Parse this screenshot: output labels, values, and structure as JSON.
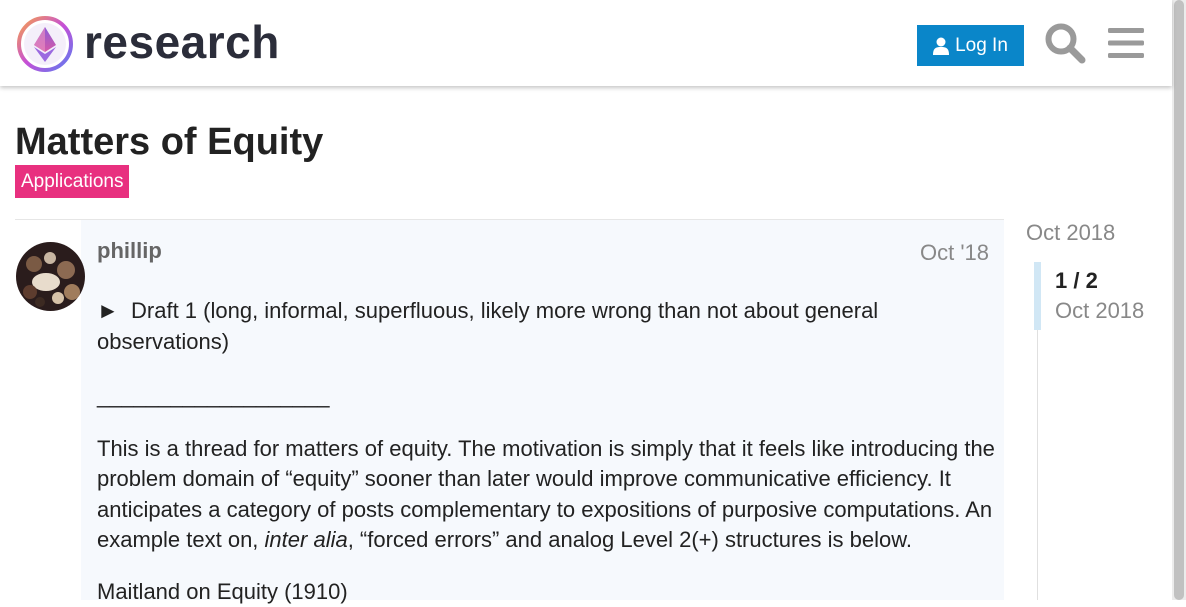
{
  "header": {
    "brand": "research",
    "login_label": "Log In"
  },
  "topic": {
    "title": "Matters of Equity",
    "category": "Applications",
    "category_color": "#e8307f"
  },
  "post": {
    "author": "phillip",
    "date": "Oct '18",
    "details_marker": "►",
    "details_summary": "Draft 1 (long, informal, superfluous, likely more wrong than not about general observations)",
    "rule": "___________________",
    "para_start": "This is a thread for matters of equity. The motivation is simply that it feels like introducing the problem domain of “equity” sooner than later would improve communicative efficiency. It anticipates a category of posts complementary to expositions of purposive computations. An example text on, ",
    "para_italic": "inter alia",
    "para_end": ", “forced errors” and analog Level 2(+) structures is below.",
    "citation": "Maitland on Equity (1910)"
  },
  "timeline": {
    "start_date": "Oct 2018",
    "position": "1 / 2",
    "current_date": "Oct 2018",
    "current_post": 1,
    "total_posts": 2
  },
  "colors": {
    "login_bg": "#0a86c9",
    "post_bg": "#f6f9fd",
    "timeline_handle": "#d1e7f5"
  },
  "icons": [
    "research-logo-icon",
    "user-icon",
    "search-icon",
    "hamburger-menu-icon"
  ]
}
